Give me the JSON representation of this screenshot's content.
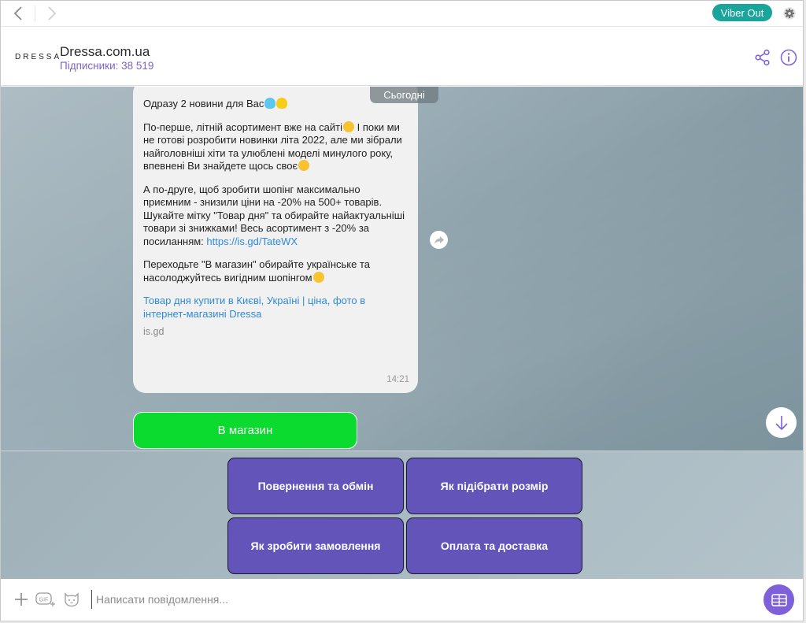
{
  "topbar": {
    "viber_out_label": "Viber Out"
  },
  "header": {
    "logo": "DRESSA",
    "title": "Dressa.com.ua",
    "subscribers": "Підписники: 38 519"
  },
  "chat": {
    "date_separator": "Сьогодні",
    "message": {
      "p1": "Одразу 2 новини для Вас",
      "p2": "По-перше, літній асортимент вже на сайті",
      "p2b": " І поки ми не готові розробити новинки літа 2022, але ми зібрали найголовніші хіти та улюблені моделі минулого року, впевнені Ви знайдете щось своє",
      "p3": "А по-друге, щоб зробити шопінг максимально приємним - знизили ціни на -20% на 500+ товарів. Шукайте мітку \"Товар дня\" та обирайте найактуальніші товари зі знижками!  Весь асортимент з -20% за посиланням: ",
      "p3_link": "https://is.gd/TateWX",
      "p4": "Переходьте \"В магазин\" обирайте українське та насолоджуйтесь вигідним шопінгом",
      "preview_title": "Товар дня купити в Києві, Україні | ціна, фото в інтернет-магазині Dressa",
      "preview_domain": "is.gd",
      "time": "14:21"
    },
    "shop_button": "В магазин"
  },
  "keyboard": {
    "buttons": [
      "Повернення та обмін",
      "Як підібрати розмір",
      "Як зробити замовлення",
      "Оплата та доставка"
    ]
  },
  "composer": {
    "placeholder": "Написати повідомлення...",
    "gif_label": "GIF"
  },
  "colors": {
    "accent": "#7e61d8",
    "keyboard_button": "#6254b8",
    "shop_button": "#0bdb2e",
    "viber_out": "#19a59c",
    "link": "#2f8ad8"
  }
}
